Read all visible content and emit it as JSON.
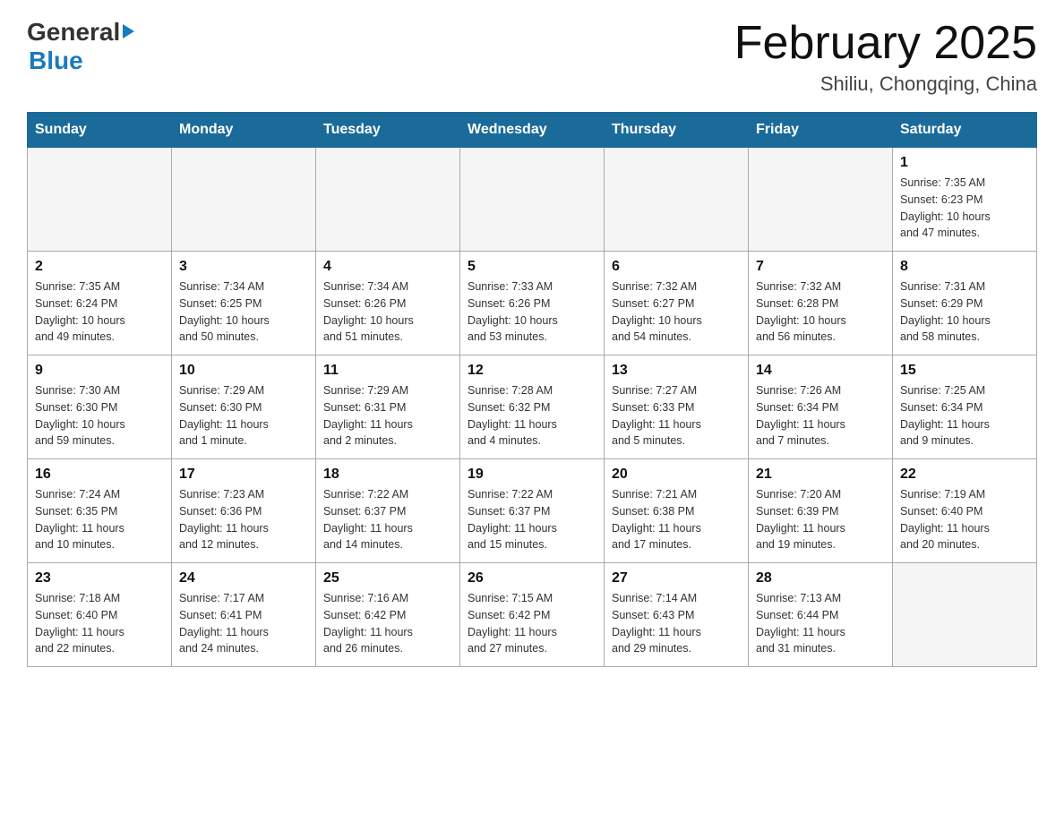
{
  "header": {
    "logo_general": "General",
    "logo_blue": "Blue",
    "month_title": "February 2025",
    "subtitle": "Shiliu, Chongqing, China"
  },
  "calendar": {
    "days_of_week": [
      "Sunday",
      "Monday",
      "Tuesday",
      "Wednesday",
      "Thursday",
      "Friday",
      "Saturday"
    ],
    "weeks": [
      [
        {
          "day": "",
          "info": "",
          "empty": true
        },
        {
          "day": "",
          "info": "",
          "empty": true
        },
        {
          "day": "",
          "info": "",
          "empty": true
        },
        {
          "day": "",
          "info": "",
          "empty": true
        },
        {
          "day": "",
          "info": "",
          "empty": true
        },
        {
          "day": "",
          "info": "",
          "empty": true
        },
        {
          "day": "1",
          "info": "Sunrise: 7:35 AM\nSunset: 6:23 PM\nDaylight: 10 hours\nand 47 minutes.",
          "empty": false
        }
      ],
      [
        {
          "day": "2",
          "info": "Sunrise: 7:35 AM\nSunset: 6:24 PM\nDaylight: 10 hours\nand 49 minutes.",
          "empty": false
        },
        {
          "day": "3",
          "info": "Sunrise: 7:34 AM\nSunset: 6:25 PM\nDaylight: 10 hours\nand 50 minutes.",
          "empty": false
        },
        {
          "day": "4",
          "info": "Sunrise: 7:34 AM\nSunset: 6:26 PM\nDaylight: 10 hours\nand 51 minutes.",
          "empty": false
        },
        {
          "day": "5",
          "info": "Sunrise: 7:33 AM\nSunset: 6:26 PM\nDaylight: 10 hours\nand 53 minutes.",
          "empty": false
        },
        {
          "day": "6",
          "info": "Sunrise: 7:32 AM\nSunset: 6:27 PM\nDaylight: 10 hours\nand 54 minutes.",
          "empty": false
        },
        {
          "day": "7",
          "info": "Sunrise: 7:32 AM\nSunset: 6:28 PM\nDaylight: 10 hours\nand 56 minutes.",
          "empty": false
        },
        {
          "day": "8",
          "info": "Sunrise: 7:31 AM\nSunset: 6:29 PM\nDaylight: 10 hours\nand 58 minutes.",
          "empty": false
        }
      ],
      [
        {
          "day": "9",
          "info": "Sunrise: 7:30 AM\nSunset: 6:30 PM\nDaylight: 10 hours\nand 59 minutes.",
          "empty": false
        },
        {
          "day": "10",
          "info": "Sunrise: 7:29 AM\nSunset: 6:30 PM\nDaylight: 11 hours\nand 1 minute.",
          "empty": false
        },
        {
          "day": "11",
          "info": "Sunrise: 7:29 AM\nSunset: 6:31 PM\nDaylight: 11 hours\nand 2 minutes.",
          "empty": false
        },
        {
          "day": "12",
          "info": "Sunrise: 7:28 AM\nSunset: 6:32 PM\nDaylight: 11 hours\nand 4 minutes.",
          "empty": false
        },
        {
          "day": "13",
          "info": "Sunrise: 7:27 AM\nSunset: 6:33 PM\nDaylight: 11 hours\nand 5 minutes.",
          "empty": false
        },
        {
          "day": "14",
          "info": "Sunrise: 7:26 AM\nSunset: 6:34 PM\nDaylight: 11 hours\nand 7 minutes.",
          "empty": false
        },
        {
          "day": "15",
          "info": "Sunrise: 7:25 AM\nSunset: 6:34 PM\nDaylight: 11 hours\nand 9 minutes.",
          "empty": false
        }
      ],
      [
        {
          "day": "16",
          "info": "Sunrise: 7:24 AM\nSunset: 6:35 PM\nDaylight: 11 hours\nand 10 minutes.",
          "empty": false
        },
        {
          "day": "17",
          "info": "Sunrise: 7:23 AM\nSunset: 6:36 PM\nDaylight: 11 hours\nand 12 minutes.",
          "empty": false
        },
        {
          "day": "18",
          "info": "Sunrise: 7:22 AM\nSunset: 6:37 PM\nDaylight: 11 hours\nand 14 minutes.",
          "empty": false
        },
        {
          "day": "19",
          "info": "Sunrise: 7:22 AM\nSunset: 6:37 PM\nDaylight: 11 hours\nand 15 minutes.",
          "empty": false
        },
        {
          "day": "20",
          "info": "Sunrise: 7:21 AM\nSunset: 6:38 PM\nDaylight: 11 hours\nand 17 minutes.",
          "empty": false
        },
        {
          "day": "21",
          "info": "Sunrise: 7:20 AM\nSunset: 6:39 PM\nDaylight: 11 hours\nand 19 minutes.",
          "empty": false
        },
        {
          "day": "22",
          "info": "Sunrise: 7:19 AM\nSunset: 6:40 PM\nDaylight: 11 hours\nand 20 minutes.",
          "empty": false
        }
      ],
      [
        {
          "day": "23",
          "info": "Sunrise: 7:18 AM\nSunset: 6:40 PM\nDaylight: 11 hours\nand 22 minutes.",
          "empty": false
        },
        {
          "day": "24",
          "info": "Sunrise: 7:17 AM\nSunset: 6:41 PM\nDaylight: 11 hours\nand 24 minutes.",
          "empty": false
        },
        {
          "day": "25",
          "info": "Sunrise: 7:16 AM\nSunset: 6:42 PM\nDaylight: 11 hours\nand 26 minutes.",
          "empty": false
        },
        {
          "day": "26",
          "info": "Sunrise: 7:15 AM\nSunset: 6:42 PM\nDaylight: 11 hours\nand 27 minutes.",
          "empty": false
        },
        {
          "day": "27",
          "info": "Sunrise: 7:14 AM\nSunset: 6:43 PM\nDaylight: 11 hours\nand 29 minutes.",
          "empty": false
        },
        {
          "day": "28",
          "info": "Sunrise: 7:13 AM\nSunset: 6:44 PM\nDaylight: 11 hours\nand 31 minutes.",
          "empty": false
        },
        {
          "day": "",
          "info": "",
          "empty": true
        }
      ]
    ]
  }
}
